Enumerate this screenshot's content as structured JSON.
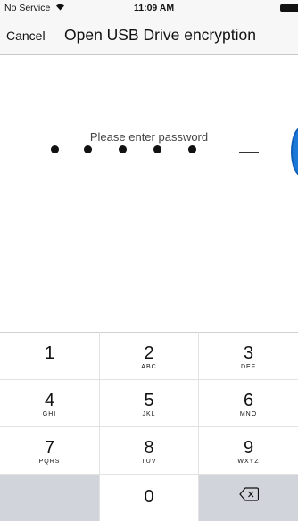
{
  "status": {
    "carrier": "No Service",
    "time": "11:09 AM"
  },
  "nav": {
    "cancel": "Cancel",
    "title": "Open USB Drive encryption"
  },
  "prompt": "Please enter password",
  "pin": {
    "entered": 5,
    "length": 6
  },
  "keypad": {
    "keys": [
      {
        "digit": "1",
        "letters": ""
      },
      {
        "digit": "2",
        "letters": "ABC"
      },
      {
        "digit": "3",
        "letters": "DEF"
      },
      {
        "digit": "4",
        "letters": "GHI"
      },
      {
        "digit": "5",
        "letters": "JKL"
      },
      {
        "digit": "6",
        "letters": "MNO"
      },
      {
        "digit": "7",
        "letters": "PQRS"
      },
      {
        "digit": "8",
        "letters": "TUV"
      },
      {
        "digit": "9",
        "letters": "WXYZ"
      },
      {
        "digit": "0",
        "letters": ""
      }
    ]
  },
  "colors": {
    "accent": "#1a78d8",
    "keypad_gray": "#d1d5db"
  },
  "icons": {
    "wifi": "wifi-icon",
    "battery": "battery-icon",
    "backspace": "backspace-icon"
  }
}
